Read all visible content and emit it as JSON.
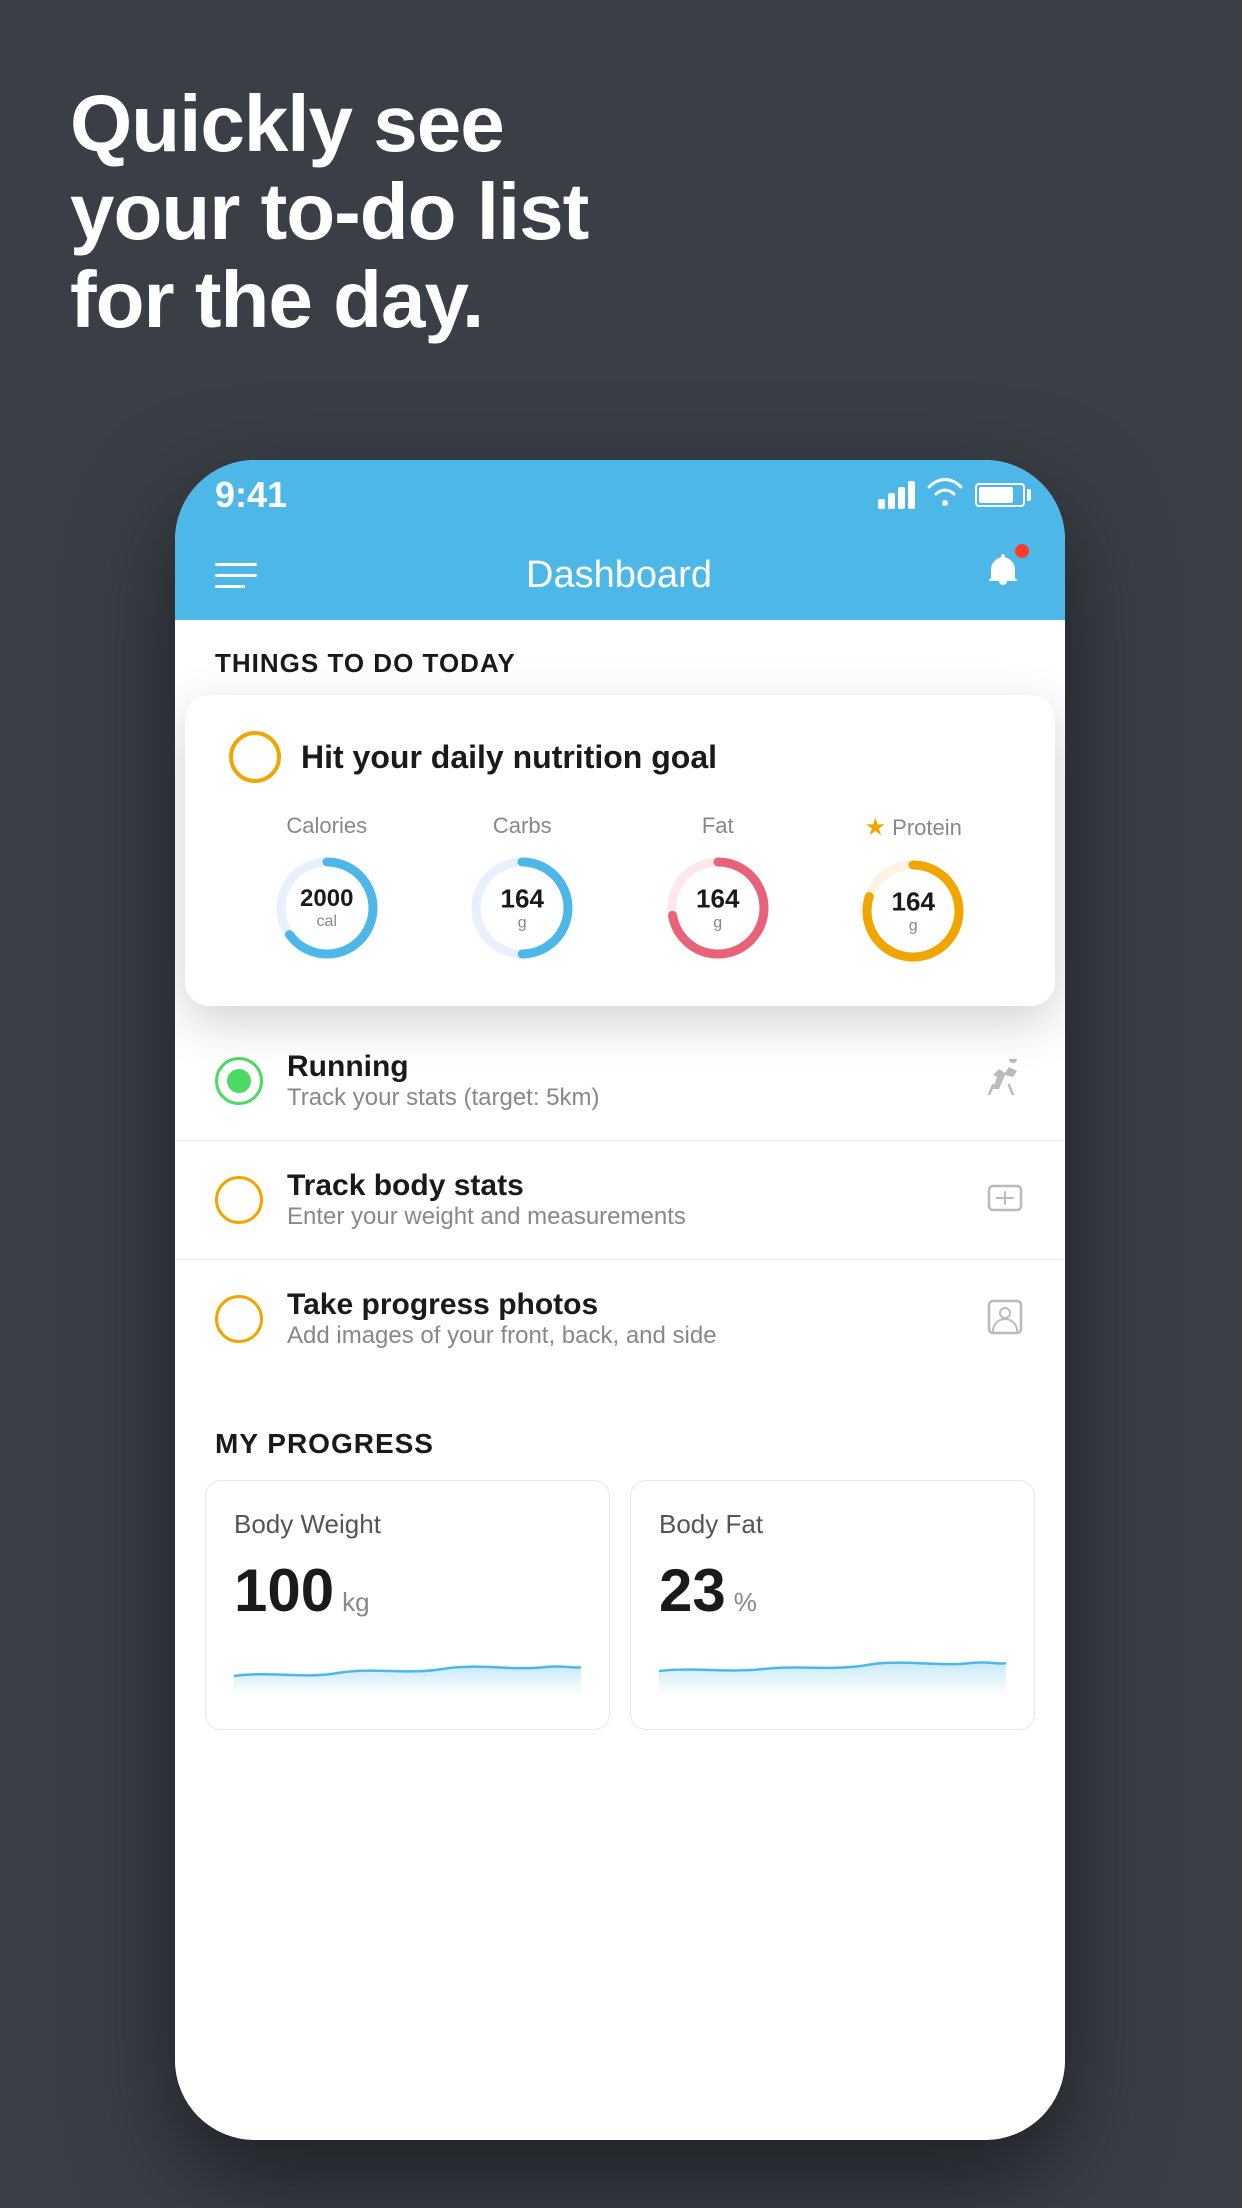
{
  "headline": {
    "line1": "Quickly see",
    "line2": "your to-do list",
    "line3": "for the day."
  },
  "status_bar": {
    "time": "9:41"
  },
  "nav": {
    "title": "Dashboard"
  },
  "things_header": "THINGS TO DO TODAY",
  "floating_card": {
    "title": "Hit your daily nutrition goal",
    "items": [
      {
        "label": "Calories",
        "value": "2000",
        "unit": "cal",
        "color": "#4db8e8",
        "percent": 65,
        "starred": false
      },
      {
        "label": "Carbs",
        "value": "164",
        "unit": "g",
        "color": "#4db8e8",
        "percent": 50,
        "starred": false
      },
      {
        "label": "Fat",
        "value": "164",
        "unit": "g",
        "color": "#e8637a",
        "percent": 72,
        "starred": false
      },
      {
        "label": "Protein",
        "value": "164",
        "unit": "g",
        "color": "#f0a500",
        "percent": 80,
        "starred": true
      }
    ]
  },
  "list_items": [
    {
      "title": "Running",
      "subtitle": "Track your stats (target: 5km)",
      "check_style": "green",
      "icon": "🏃"
    },
    {
      "title": "Track body stats",
      "subtitle": "Enter your weight and measurements",
      "check_style": "yellow",
      "icon": "⚖"
    },
    {
      "title": "Take progress photos",
      "subtitle": "Add images of your front, back, and side",
      "check_style": "yellow",
      "icon": "👤"
    }
  ],
  "progress": {
    "header": "MY PROGRESS",
    "cards": [
      {
        "title": "Body Weight",
        "value": "100",
        "unit": "kg"
      },
      {
        "title": "Body Fat",
        "value": "23",
        "unit": "%"
      }
    ]
  }
}
